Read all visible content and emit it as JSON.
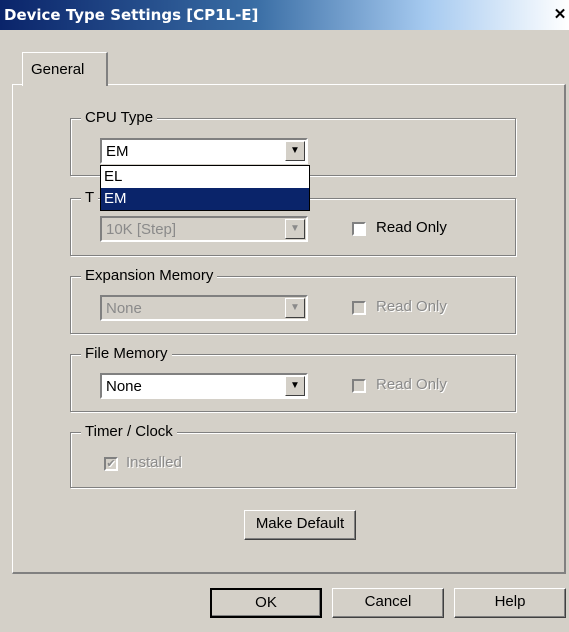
{
  "window": {
    "title": "Device Type Settings [CP1L-E]",
    "close_glyph": "✕"
  },
  "tab": {
    "label": "General"
  },
  "cpu_type": {
    "legend": "CPU Type",
    "value": "EM",
    "options": [
      "EL",
      "EM"
    ],
    "selected": "EM"
  },
  "program_memory": {
    "legend_partial": "T",
    "value": "10K [Step]",
    "read_only_label": "Read Only",
    "read_only_checked": false
  },
  "expansion_memory": {
    "legend": "Expansion Memory",
    "value": "None",
    "read_only_label": "Read Only"
  },
  "file_memory": {
    "legend": "File Memory",
    "value": "None",
    "read_only_label": "Read Only"
  },
  "timer_clock": {
    "legend": "Timer / Clock",
    "installed_label": "Installed",
    "installed_checked": true
  },
  "buttons": {
    "make_default": "Make Default",
    "ok": "OK",
    "cancel": "Cancel",
    "help": "Help"
  },
  "icons": {
    "dropdown_arrow": "▼",
    "check": "✔"
  },
  "colors": {
    "face": "#d4d0c8",
    "selection": "#0a246a",
    "title_start": "#0a246a"
  }
}
